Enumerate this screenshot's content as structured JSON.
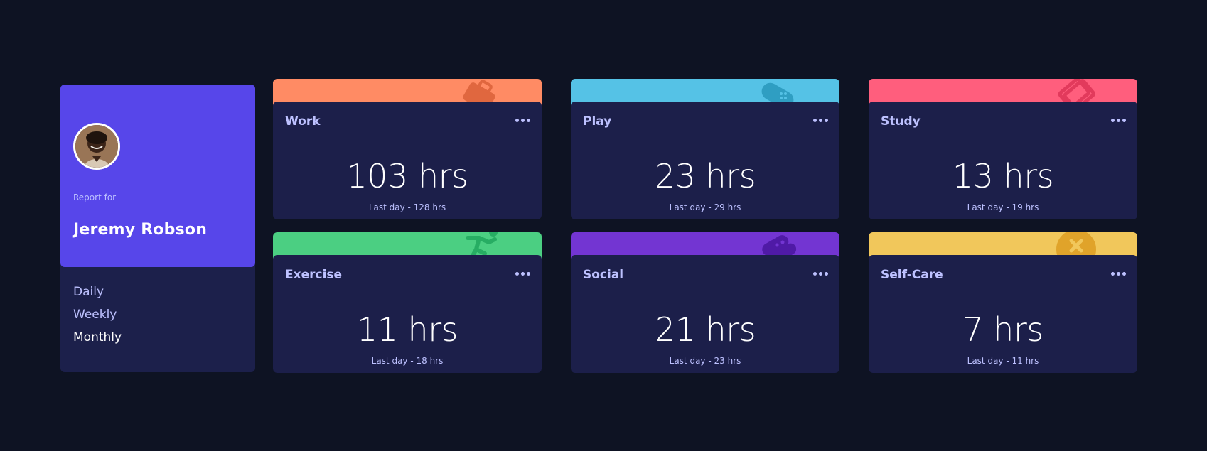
{
  "profile": {
    "report_label": "Report for",
    "name": "Jeremy Robson",
    "timeframes": [
      "Daily",
      "Weekly",
      "Monthly"
    ],
    "active_timeframe": "Monthly"
  },
  "cards": [
    {
      "title": "Work",
      "hours": "103 hrs",
      "last": "Last day - 128 hrs",
      "color": "#ff8b64",
      "icon": "briefcase-icon"
    },
    {
      "title": "Play",
      "hours": "23 hrs",
      "last": "Last day - 29 hrs",
      "color": "#55c2e6",
      "icon": "gamepad-icon"
    },
    {
      "title": "Study",
      "hours": "13 hrs",
      "last": "Last day - 19 hrs",
      "color": "#ff5e7d",
      "icon": "book-icon"
    },
    {
      "title": "Exercise",
      "hours": "11 hrs",
      "last": "Last day - 18 hrs",
      "color": "#4bcf82",
      "icon": "runner-icon"
    },
    {
      "title": "Social",
      "hours": "21 hrs",
      "last": "Last day - 23 hrs",
      "color": "#7335d2",
      "icon": "chat-icon"
    },
    {
      "title": "Self-Care",
      "hours": "7 hrs",
      "last": "Last day - 11 hrs",
      "color": "#f1c75b",
      "icon": "bandage-icon"
    }
  ],
  "colors": {
    "page_bg": "#0e1323",
    "card_bg": "#1c1f4a",
    "profile_accent": "#5746ea",
    "muted_text": "#bdc1ff"
  }
}
